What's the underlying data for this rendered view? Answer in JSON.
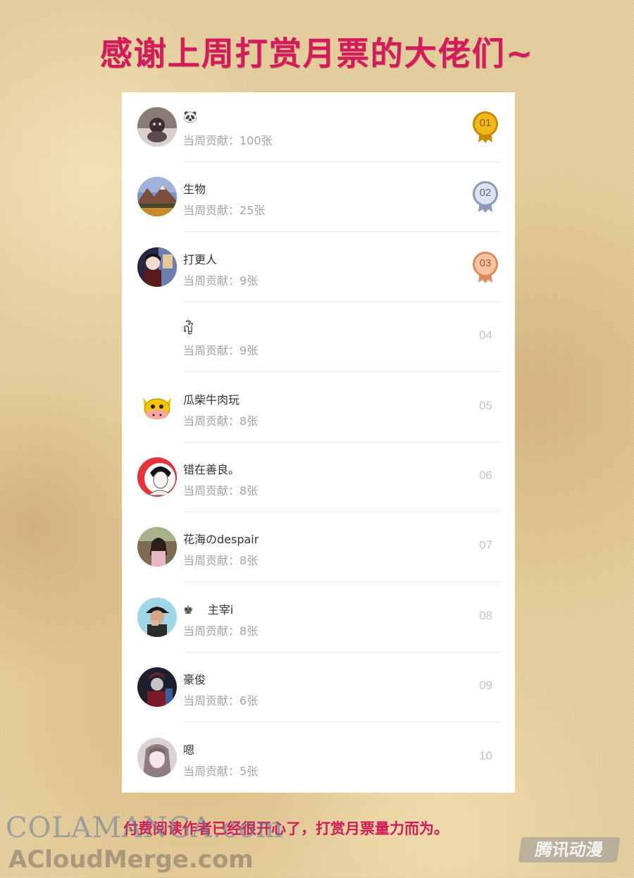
{
  "title": "感谢上周打赏月票的大佬们~",
  "ranking": [
    {
      "name": "🐼",
      "contribution": "当周贡献：100张",
      "rank": "01",
      "medal": "gold",
      "avatar": "dark-photo"
    },
    {
      "name": "生物",
      "contribution": "当周贡献：25张",
      "rank": "02",
      "medal": "silver",
      "avatar": "mountain-landscape"
    },
    {
      "name": "打更人",
      "contribution": "当周贡献：9张",
      "rank": "03",
      "medal": "bronze",
      "avatar": "anime-character"
    },
    {
      "name": "ญ๊ิ๊ิ๊ิ๊ิ๊ิ๊ิ๊ิ๊ิ๊ิ๊ิ๊ิ๊ิ๊ิ",
      "contribution": "当周贡献：9张",
      "rank": "04",
      "medal": "",
      "avatar": "blank"
    },
    {
      "name": "瓜柴牛肉玩",
      "contribution": "当周贡献：8张",
      "rank": "05",
      "medal": "",
      "avatar": "cartoon-cow"
    },
    {
      "name": "错在善良。",
      "contribution": "当周贡献：8张",
      "rank": "06",
      "medal": "",
      "avatar": "sketch-boy"
    },
    {
      "name": "花海のdespair",
      "contribution": "当周贡献：8张",
      "rank": "07",
      "medal": "",
      "avatar": "girl-photo"
    },
    {
      "name": "♚    主宰i",
      "contribution": "当周贡献：8张",
      "rank": "08",
      "medal": "",
      "avatar": "man-cap"
    },
    {
      "name": "豪俊",
      "contribution": "当周贡献：6张",
      "rank": "09",
      "medal": "",
      "avatar": "game-character"
    },
    {
      "name": "嗯",
      "contribution": "当周贡献：5张",
      "rank": "10",
      "medal": "",
      "avatar": "anime-girl"
    }
  ],
  "footer_note": "付费阅读作者已经很开心了，打赏月票量力而为。",
  "watermarks": {
    "colamanga": "COLAMANGA.com",
    "acloud": "ACloudMerge.com",
    "tencent": "腾讯动漫"
  },
  "colors": {
    "title": "#d31a5a",
    "gold": "#e8a81c",
    "silver": "#b8c4d8",
    "bronze": "#f0a880"
  }
}
